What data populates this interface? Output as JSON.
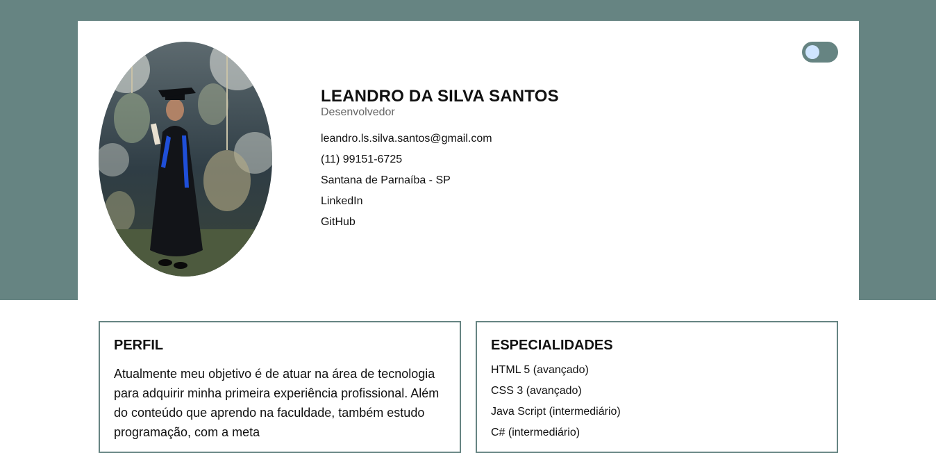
{
  "profile": {
    "name": "LEANDRO DA SILVA SANTOS",
    "role": "Desenvolvedor",
    "contacts": [
      {
        "label": "leandro.ls.silva.santos@gmail.com",
        "type": "email"
      },
      {
        "label": "(11) 99151-6725",
        "type": "phone"
      },
      {
        "label": "Santana de Parnaíba - SP",
        "type": "location"
      },
      {
        "label": "LinkedIn",
        "type": "link"
      },
      {
        "label": "GitHub",
        "type": "link"
      }
    ],
    "photo_icon": "graduation-photo"
  },
  "theme_toggle": {
    "state": "off",
    "icon": "toggle-switch",
    "colors": {
      "track": "#668482",
      "knob": "#cfe5ff"
    }
  },
  "perfil": {
    "title": "PERFIL",
    "text": "Atualmente meu objetivo é de atuar na área de tecnologia para adquirir minha primeira experiência profissional. Além do conteúdo que aprendo na faculdade, também estudo programação, com a meta"
  },
  "especialidades": {
    "title": "ESPECIALIDADES",
    "items": [
      "HTML 5 (avançado)",
      "CSS 3 (avançado)",
      "Java Script (intermediário)",
      "C# (intermediário)"
    ]
  },
  "colors": {
    "accent": "#668482",
    "background": "#ffffff"
  }
}
